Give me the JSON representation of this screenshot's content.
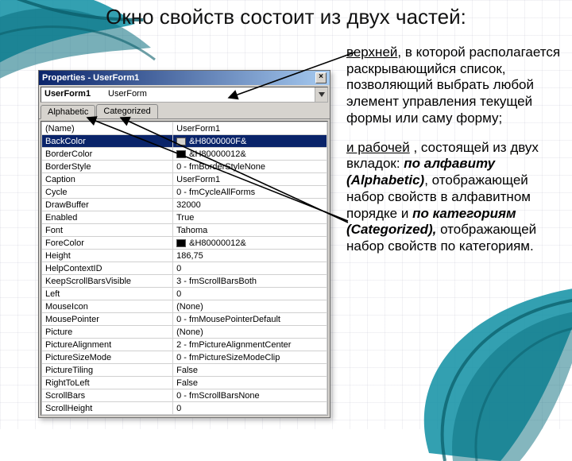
{
  "heading": "Окно свойств состоит из двух частей:",
  "description": {
    "para1": {
      "u": "верхней",
      "rest": ", в которой располагается раскрывающийся список, позволяющий выбрать любой элемент управления текущей формы или саму форму;"
    },
    "para2": {
      "u": "и рабочей",
      "mid1": " , состоящей из двух вкладок: ",
      "b1": "по алфавиту (Alphabetic)",
      "mid2": ", отображающей набор свойств в алфавитном порядке и ",
      "b2": "по категориям (Categorized),",
      "rest": " отображающей набор свойств по категориям."
    }
  },
  "propwin": {
    "title": "Properties - UserForm1",
    "close_glyph": "×",
    "object": {
      "name": "UserForm1",
      "type": "UserForm"
    },
    "tabs": {
      "alphabetic": "Alphabetic",
      "categorized": "Categorized"
    },
    "rows": [
      {
        "name": "(Name)",
        "value": "UserForm1"
      },
      {
        "name": "BackColor",
        "value": "&H8000000F&",
        "color": "#d6d3ce",
        "selected": true
      },
      {
        "name": "BorderColor",
        "value": "&H80000012&",
        "color": "#000000"
      },
      {
        "name": "BorderStyle",
        "value": "0 - fmBorderStyleNone"
      },
      {
        "name": "Caption",
        "value": "UserForm1"
      },
      {
        "name": "Cycle",
        "value": "0 - fmCycleAllForms"
      },
      {
        "name": "DrawBuffer",
        "value": "32000"
      },
      {
        "name": "Enabled",
        "value": "True"
      },
      {
        "name": "Font",
        "value": "Tahoma"
      },
      {
        "name": "ForeColor",
        "value": "&H80000012&",
        "color": "#000000"
      },
      {
        "name": "Height",
        "value": "186,75"
      },
      {
        "name": "HelpContextID",
        "value": "0"
      },
      {
        "name": "KeepScrollBarsVisible",
        "value": "3 - fmScrollBarsBoth"
      },
      {
        "name": "Left",
        "value": "0"
      },
      {
        "name": "MouseIcon",
        "value": "(None)"
      },
      {
        "name": "MousePointer",
        "value": "0 - fmMousePointerDefault"
      },
      {
        "name": "Picture",
        "value": "(None)"
      },
      {
        "name": "PictureAlignment",
        "value": "2 - fmPictureAlignmentCenter"
      },
      {
        "name": "PictureSizeMode",
        "value": "0 - fmPictureSizeModeClip"
      },
      {
        "name": "PictureTiling",
        "value": "False"
      },
      {
        "name": "RightToLeft",
        "value": "False"
      },
      {
        "name": "ScrollBars",
        "value": "0 - fmScrollBarsNone"
      },
      {
        "name": "ScrollHeight",
        "value": "0"
      }
    ]
  }
}
